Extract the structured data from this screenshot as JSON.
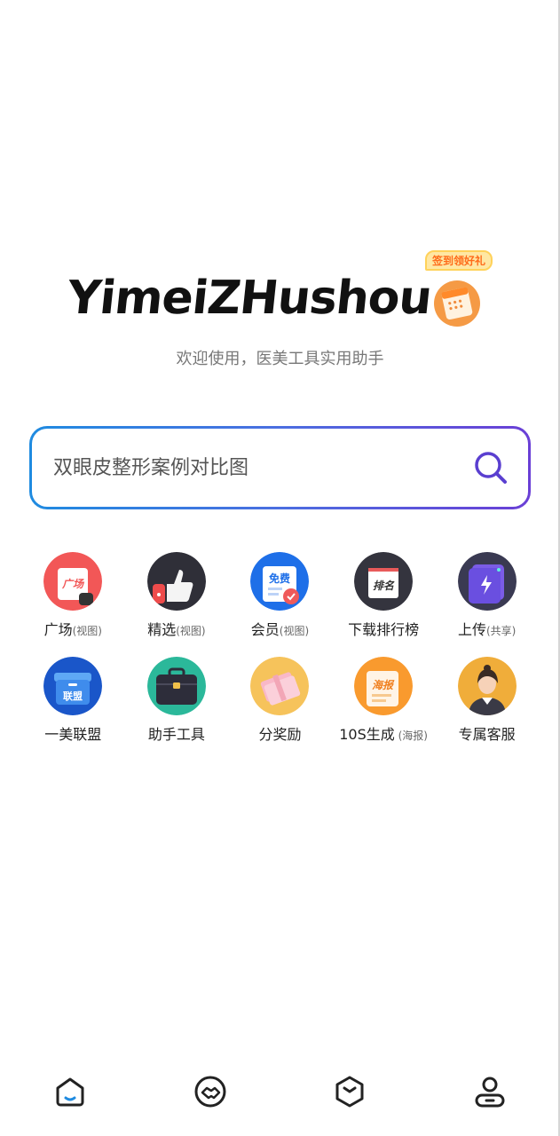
{
  "brand": {
    "logo_text": "YimeiZHushou",
    "promo_tag": "签到领好礼",
    "subtitle": "欢迎使用，医美工具实用助手"
  },
  "search": {
    "placeholder": "双眼皮整形案例对比图"
  },
  "grid": [
    {
      "label": "广场",
      "sub": "(视图)",
      "icon": "plaza-icon"
    },
    {
      "label": "精选",
      "sub": "(视图)",
      "icon": "thumbs-up-icon"
    },
    {
      "label": "会员",
      "sub": "(视图)",
      "icon": "membership-icon"
    },
    {
      "label": "下载排行榜",
      "sub": "",
      "icon": "ranking-icon"
    },
    {
      "label": "上传",
      "sub": "(共享)",
      "icon": "upload-icon"
    },
    {
      "label": "一美联盟",
      "sub": "",
      "icon": "alliance-icon"
    },
    {
      "label": "助手工具",
      "sub": "",
      "icon": "toolbox-icon"
    },
    {
      "label": "分奖励",
      "sub": "",
      "icon": "reward-icon"
    },
    {
      "label": "10S生成",
      "sub": " (海报)",
      "icon": "poster-icon"
    },
    {
      "label": "专属客服",
      "sub": "",
      "icon": "customer-service-icon"
    }
  ],
  "icon_texts": {
    "plaza": "广场",
    "membership": "免费",
    "ranking": "排名",
    "alliance": "联盟",
    "poster": "海报"
  },
  "colors": {
    "accent_blue": "#1f8be0",
    "accent_purple": "#6a3fd6"
  },
  "nav": [
    {
      "name": "home",
      "icon": "home-icon"
    },
    {
      "name": "cooperation",
      "icon": "handshake-icon"
    },
    {
      "name": "box",
      "icon": "box-icon"
    },
    {
      "name": "profile",
      "icon": "user-icon"
    }
  ]
}
